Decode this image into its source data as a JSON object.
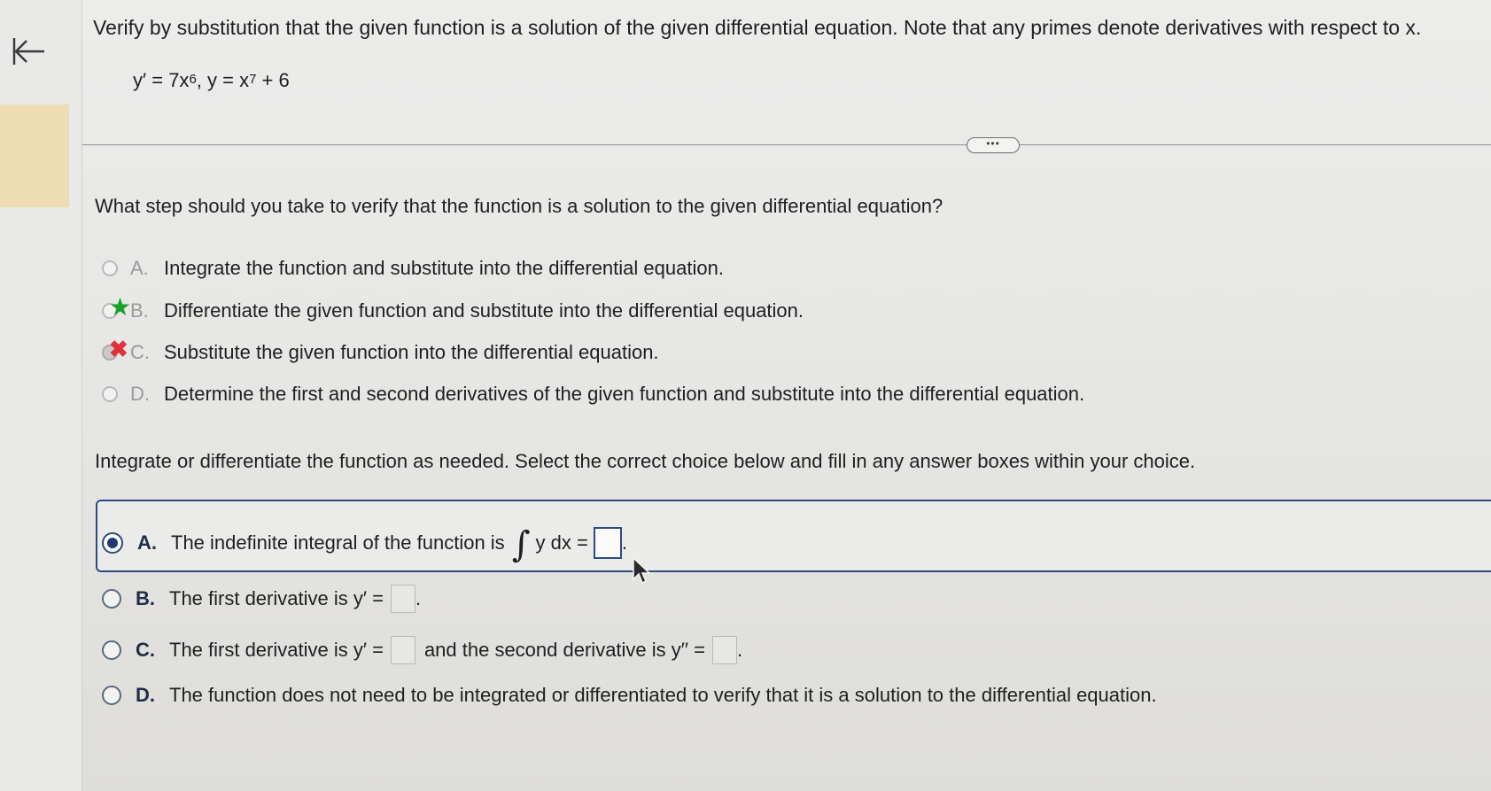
{
  "nav": {
    "back_icon": "back-to-start-icon"
  },
  "problem": {
    "instructions": "Verify by substitution that the given function is a solution of the given differential equation. Note that any primes denote derivatives with respect to x.",
    "equation": {
      "yprime_lhs": "y′ = 7x",
      "exp1": "6",
      "sep": ", y = x",
      "exp2": "7",
      "rest": " + 6"
    }
  },
  "more_button": {
    "label": "•••"
  },
  "part1": {
    "question": "What step should you take to verify that the function is a solution to the given differential equation?",
    "options": [
      {
        "letter": "A.",
        "text": "Integrate the function and substitute into the differential equation."
      },
      {
        "letter": "B.",
        "text": "Differentiate the given function and substitute into the differential equation.",
        "mark": "correct"
      },
      {
        "letter": "C.",
        "text": "Substitute the given function into the differential equation.",
        "mark": "incorrect"
      },
      {
        "letter": "D.",
        "text": "Determine the first and second derivatives of the given function and substitute into the differential equation."
      }
    ],
    "star_glyph": "★",
    "x_glyph": "✖"
  },
  "part2": {
    "instruction": "Integrate or differentiate the function as needed. Select the correct choice below and fill in any answer boxes within your choice.",
    "options": [
      {
        "letter": "A.",
        "text_before": "The indefinite integral of the function is",
        "integral_symbol": "∫",
        "integral_body": "y dx =",
        "suffix": ".",
        "selected": true
      },
      {
        "letter": "B.",
        "text_before": "The first derivative is y′ =",
        "suffix": "."
      },
      {
        "letter": "C.",
        "text_before": "The first derivative is y′ =",
        "text_middle": "and the second derivative is y′′ =",
        "suffix": "."
      },
      {
        "letter": "D.",
        "text": "The function does not need to be integrated or differentiated to verify that it is a solution to the differential equation."
      }
    ]
  },
  "colors": {
    "accent": "#2a4c82",
    "correct": "#17a02a",
    "incorrect": "#e0303a",
    "tab": "#eedcb2"
  }
}
